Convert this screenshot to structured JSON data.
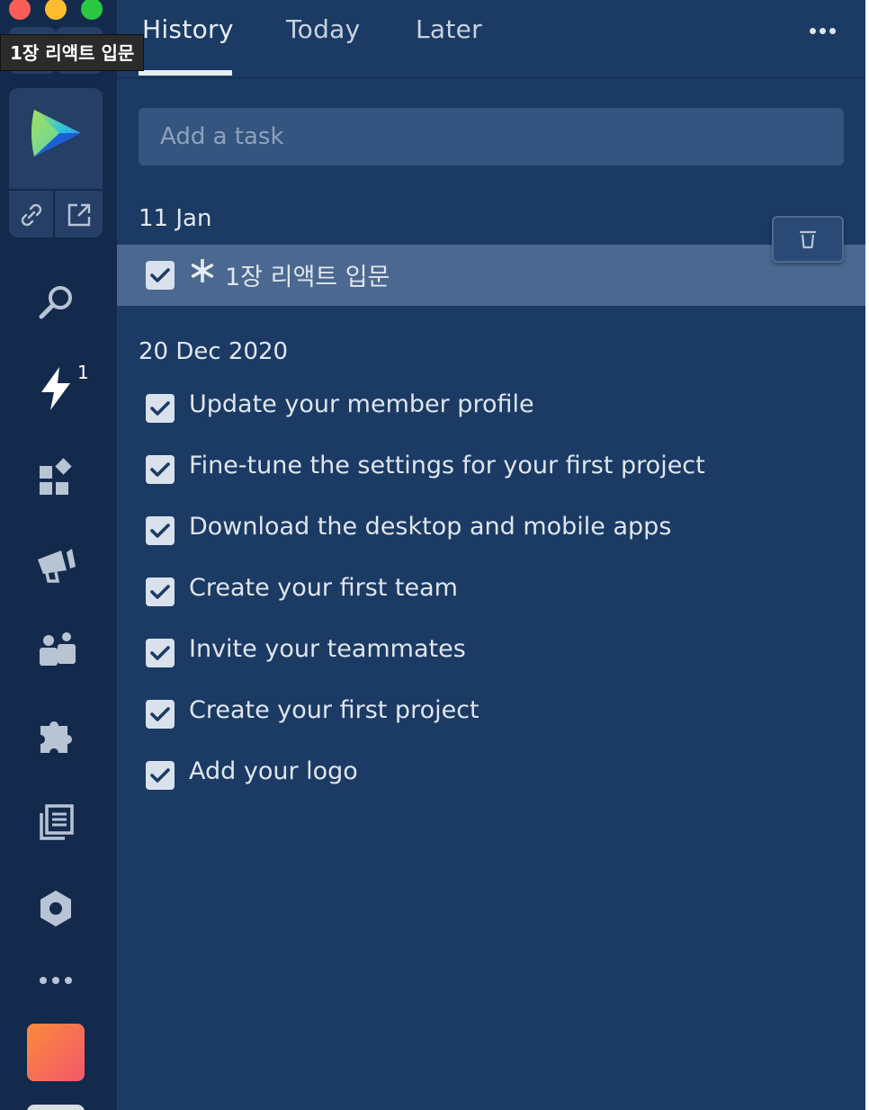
{
  "window": {
    "traffic_lights": [
      "close",
      "minimize",
      "zoom"
    ],
    "tooltip": "1장 리액트 입문"
  },
  "sidebar": {
    "app_icons": [
      "link-icon",
      "external-link-icon"
    ],
    "nav": [
      {
        "name": "search-icon"
      },
      {
        "name": "lightning-icon",
        "badge": "1"
      },
      {
        "name": "widgets-icon"
      },
      {
        "name": "megaphone-icon"
      },
      {
        "name": "team-icon"
      },
      {
        "name": "puzzle-icon"
      },
      {
        "name": "library-icon"
      },
      {
        "name": "settings-icon"
      },
      {
        "name": "more-icon"
      }
    ]
  },
  "tabs": [
    {
      "label": "History",
      "active": true
    },
    {
      "label": "Today",
      "active": false
    },
    {
      "label": "Later",
      "active": false
    }
  ],
  "add_task": {
    "placeholder": "Add a task"
  },
  "groups": [
    {
      "date": "11 Jan",
      "tasks": [
        {
          "label": "1장 리액트 입문",
          "done": true,
          "starred": true,
          "selected": true
        }
      ]
    },
    {
      "date": "20 Dec 2020",
      "tasks": [
        {
          "label": "Update your member profile",
          "done": true
        },
        {
          "label": "Fine-tune the settings for your first project",
          "done": true
        },
        {
          "label": "Download the desktop and mobile apps",
          "done": true
        },
        {
          "label": "Create your first team",
          "done": true
        },
        {
          "label": "Invite your teammates",
          "done": true
        },
        {
          "label": "Create your first project",
          "done": true
        },
        {
          "label": "Add your logo",
          "done": true
        }
      ]
    }
  ],
  "colors": {
    "sidebar_bg": "#142a4d",
    "main_bg": "#1b3a64",
    "selected_row": "#4b6890",
    "input_bg": "#34557f"
  }
}
